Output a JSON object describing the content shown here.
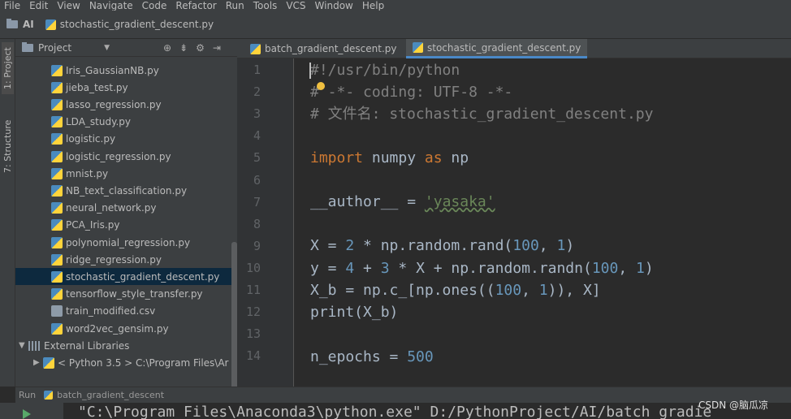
{
  "menu": [
    "File",
    "Edit",
    "View",
    "Navigate",
    "Code",
    "Refactor",
    "Run",
    "Tools",
    "VCS",
    "Window",
    "Help"
  ],
  "navbar": {
    "project": "AI",
    "file": "stochastic_gradient_descent.py"
  },
  "toolstrip": {
    "project_tab": "1: Project",
    "structure_tab": "7: Structure"
  },
  "project_panel": {
    "title": "Project",
    "files": [
      "Iris_GaussianNB.py",
      "jieba_test.py",
      "lasso_regression.py",
      "LDA_study.py",
      "logistic.py",
      "logistic_regression.py",
      "mnist.py",
      "NB_text_classification.py",
      "neural_network.py",
      "PCA_Iris.py",
      "polynomial_regression.py",
      "ridge_regression.py",
      "stochastic_gradient_descent.py",
      "tensorflow_style_transfer.py",
      "train_modified.csv",
      "word2vec_gensim.py"
    ],
    "selected_index": 12,
    "external_libraries": "External Libraries",
    "python_sdk": "< Python 3.5 >  C:\\Program Files\\Ar"
  },
  "tabs": [
    "batch_gradient_descent.py",
    "stochastic_gradient_descent.py"
  ],
  "active_tab": 1,
  "line_numbers": [
    "1",
    "2",
    "3",
    "4",
    "5",
    "6",
    "7",
    "8",
    "9",
    "10",
    "11",
    "12",
    "13",
    "14"
  ],
  "code": {
    "l1": "#!/usr/bin/python",
    "l2": "# -*- coding: UTF-8 -*-",
    "l3": "# 文件名: stochastic_gradient_descent.py",
    "l5_kw1": "import",
    "l5_mid": " numpy ",
    "l5_kw2": "as",
    "l5_end": " np",
    "l7_a": "__author__ = ",
    "l7_s": "'yasaka'",
    "l9": "X = 2 * np.random.rand(100, 1)",
    "l10": "y = 4 + 3 * X + np.random.randn(100, 1)",
    "l11": "X_b = np.c_[np.ones((100, 1)), X]",
    "l12": "print(X_b)",
    "l14_a": "n_epochs = ",
    "l14_n": "500"
  },
  "run": {
    "label": "Run",
    "config": "batch_gradient_descent",
    "output": "\"C:\\Program Files\\Anaconda3\\python.exe\" D:/PythonProject/AI/batch_gradie"
  },
  "watermark": "CSDN @脑瓜凉"
}
